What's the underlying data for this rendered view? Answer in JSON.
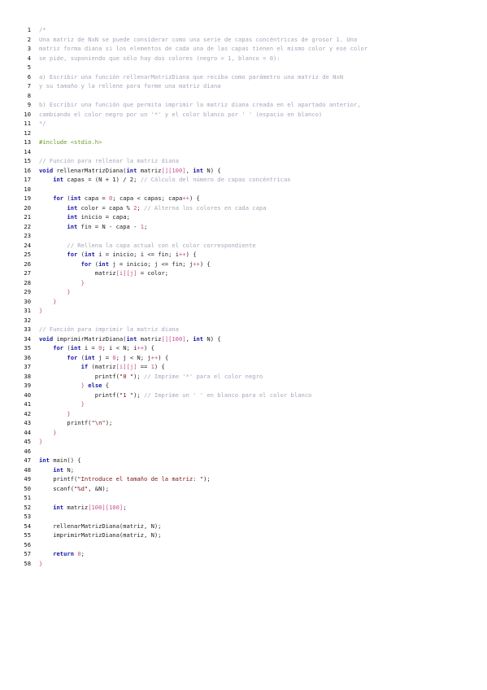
{
  "document": {
    "lines": [
      [
        {
          "t": "/*",
          "c": "c"
        }
      ],
      [
        {
          "t": "Una matriz de NxN se puede considerar como una serie de capas concéntricas de grosor 1. Una",
          "c": "c"
        }
      ],
      [
        {
          "t": "matriz forma diana si los elementos de cada una de las capas tienen el mismo color y ese color",
          "c": "c"
        }
      ],
      [
        {
          "t": "se pide, suponiendo que sólo hay dos colores (negro = 1, blanco = 0):",
          "c": "c"
        }
      ],
      [],
      [
        {
          "t": "a) Escribir una función rellenarMatrizDiana que reciba como parámetro una matriz de NxN",
          "c": "c"
        }
      ],
      [
        {
          "t": "y su tamaño y la rellene para forme una matriz diana",
          "c": "c"
        }
      ],
      [],
      [
        {
          "t": "b) Escribir una función que permita imprimir la matriz diana creada en el apartado anterior,",
          "c": "c"
        }
      ],
      [
        {
          "t": "cambiando el color negro por un '*' y el color blanco por ' ' (espacio en blanco)",
          "c": "c"
        }
      ],
      [
        {
          "t": "*/",
          "c": "c"
        }
      ],
      [],
      [
        {
          "t": "#include <stdio.h>",
          "c": "d"
        }
      ],
      [],
      [
        {
          "t": "// Función para rellenar la matriz diana",
          "c": "c"
        }
      ],
      [
        {
          "t": "void",
          "c": "k"
        },
        {
          "t": " rellenarMatrizDiana("
        },
        {
          "t": "int",
          "c": "k"
        },
        {
          "t": " matriz"
        },
        {
          "t": "[][100]",
          "c": "p"
        },
        {
          "t": ", "
        },
        {
          "t": "int",
          "c": "k"
        },
        {
          "t": " N) {"
        }
      ],
      [
        {
          "t": "    "
        },
        {
          "t": "int",
          "c": "k"
        },
        {
          "t": " capas = (N + 1) / 2; "
        },
        {
          "t": "// Cálculo del número de capas concéntricas",
          "c": "c"
        }
      ],
      [],
      [
        {
          "t": "    "
        },
        {
          "t": "for",
          "c": "k"
        },
        {
          "t": " ("
        },
        {
          "t": "int",
          "c": "k"
        },
        {
          "t": " capa = "
        },
        {
          "t": "0",
          "c": "n"
        },
        {
          "t": "; capa < capas; capa"
        },
        {
          "t": "++",
          "c": "p"
        },
        {
          "t": ") {"
        }
      ],
      [
        {
          "t": "        "
        },
        {
          "t": "int",
          "c": "k"
        },
        {
          "t": " color = capa % "
        },
        {
          "t": "2",
          "c": "n"
        },
        {
          "t": "; "
        },
        {
          "t": "// Alterna los colores en cada capa",
          "c": "c"
        }
      ],
      [
        {
          "t": "        "
        },
        {
          "t": "int",
          "c": "k"
        },
        {
          "t": " inicio = capa;"
        }
      ],
      [
        {
          "t": "        "
        },
        {
          "t": "int",
          "c": "k"
        },
        {
          "t": " fin = N - capa - "
        },
        {
          "t": "1",
          "c": "n"
        },
        {
          "t": ";"
        }
      ],
      [],
      [
        {
          "t": "        "
        },
        {
          "t": "// Rellena la capa actual con el color correspondiente",
          "c": "c"
        }
      ],
      [
        {
          "t": "        "
        },
        {
          "t": "for",
          "c": "k"
        },
        {
          "t": " ("
        },
        {
          "t": "int",
          "c": "k"
        },
        {
          "t": " i = inicio; i <= fin; i"
        },
        {
          "t": "++",
          "c": "p"
        },
        {
          "t": ") {"
        }
      ],
      [
        {
          "t": "            "
        },
        {
          "t": "for",
          "c": "k"
        },
        {
          "t": " ("
        },
        {
          "t": "int",
          "c": "k"
        },
        {
          "t": " j = inicio; j <= fin; j"
        },
        {
          "t": "++",
          "c": "p"
        },
        {
          "t": ") {"
        }
      ],
      [
        {
          "t": "                matriz"
        },
        {
          "t": "[i][j]",
          "c": "p"
        },
        {
          "t": " = color;"
        }
      ],
      [
        {
          "t": "            "
        },
        {
          "t": "}",
          "c": "p"
        }
      ],
      [
        {
          "t": "        "
        },
        {
          "t": "}",
          "c": "p"
        }
      ],
      [
        {
          "t": "    "
        },
        {
          "t": "}",
          "c": "p"
        }
      ],
      [
        {
          "t": "}",
          "c": "p"
        }
      ],
      [],
      [
        {
          "t": "// Función para imprimir la matriz diana",
          "c": "c"
        }
      ],
      [
        {
          "t": "void",
          "c": "k"
        },
        {
          "t": " imprimirMatrizDiana("
        },
        {
          "t": "int",
          "c": "k"
        },
        {
          "t": " matriz"
        },
        {
          "t": "[][100]",
          "c": "p"
        },
        {
          "t": ", "
        },
        {
          "t": "int",
          "c": "k"
        },
        {
          "t": " N) {"
        }
      ],
      [
        {
          "t": "    "
        },
        {
          "t": "for",
          "c": "k"
        },
        {
          "t": " ("
        },
        {
          "t": "int",
          "c": "k"
        },
        {
          "t": " i = "
        },
        {
          "t": "0",
          "c": "n"
        },
        {
          "t": "; i < N; i"
        },
        {
          "t": "++",
          "c": "p"
        },
        {
          "t": ") {"
        }
      ],
      [
        {
          "t": "        "
        },
        {
          "t": "for",
          "c": "k"
        },
        {
          "t": " ("
        },
        {
          "t": "int",
          "c": "k"
        },
        {
          "t": " j = "
        },
        {
          "t": "0",
          "c": "n"
        },
        {
          "t": "; j < N; j"
        },
        {
          "t": "++",
          "c": "p"
        },
        {
          "t": ") {"
        }
      ],
      [
        {
          "t": "            "
        },
        {
          "t": "if",
          "c": "k"
        },
        {
          "t": " (matriz"
        },
        {
          "t": "[i][j]",
          "c": "p"
        },
        {
          "t": " == "
        },
        {
          "t": "1",
          "c": "n"
        },
        {
          "t": ") {"
        }
      ],
      [
        {
          "t": "                printf("
        },
        {
          "t": "\"0 \"",
          "c": "s"
        },
        {
          "t": "); "
        },
        {
          "t": "// Imprime '*' para el color negro",
          "c": "c"
        }
      ],
      [
        {
          "t": "            "
        },
        {
          "t": "}",
          "c": "p"
        },
        {
          "t": " "
        },
        {
          "t": "else",
          "c": "k"
        },
        {
          "t": " {"
        }
      ],
      [
        {
          "t": "                printf("
        },
        {
          "t": "\"1 \"",
          "c": "s"
        },
        {
          "t": "); "
        },
        {
          "t": "// Imprime un ' ' en blanco para el color blanco",
          "c": "c"
        }
      ],
      [
        {
          "t": "            "
        },
        {
          "t": "}",
          "c": "p"
        }
      ],
      [
        {
          "t": "        "
        },
        {
          "t": "}",
          "c": "p"
        }
      ],
      [
        {
          "t": "        printf("
        },
        {
          "t": "\"\\n\"",
          "c": "s"
        },
        {
          "t": ");"
        }
      ],
      [
        {
          "t": "    "
        },
        {
          "t": "}",
          "c": "p"
        }
      ],
      [
        {
          "t": "}",
          "c": "p"
        }
      ],
      [],
      [
        {
          "t": "int",
          "c": "k"
        },
        {
          "t": " main() {"
        }
      ],
      [
        {
          "t": "    "
        },
        {
          "t": "int",
          "c": "k"
        },
        {
          "t": " N;"
        }
      ],
      [
        {
          "t": "    printf("
        },
        {
          "t": "\"Introduce el tamaño de la matriz: \"",
          "c": "s"
        },
        {
          "t": ");"
        }
      ],
      [
        {
          "t": "    scanf("
        },
        {
          "t": "\"%d\"",
          "c": "s"
        },
        {
          "t": ", &N);"
        }
      ],
      [],
      [
        {
          "t": "    "
        },
        {
          "t": "int",
          "c": "k"
        },
        {
          "t": " matriz"
        },
        {
          "t": "[100][100]",
          "c": "p"
        },
        {
          "t": ";"
        }
      ],
      [],
      [
        {
          "t": "    rellenarMatrizDiana(matriz, N);"
        }
      ],
      [
        {
          "t": "    imprimirMatrizDiana(matriz, N);"
        }
      ],
      [],
      [
        {
          "t": "    "
        },
        {
          "t": "return",
          "c": "k"
        },
        {
          "t": " "
        },
        {
          "t": "0",
          "c": "n"
        },
        {
          "t": ";"
        }
      ],
      [
        {
          "t": "}",
          "c": "p"
        }
      ]
    ]
  }
}
